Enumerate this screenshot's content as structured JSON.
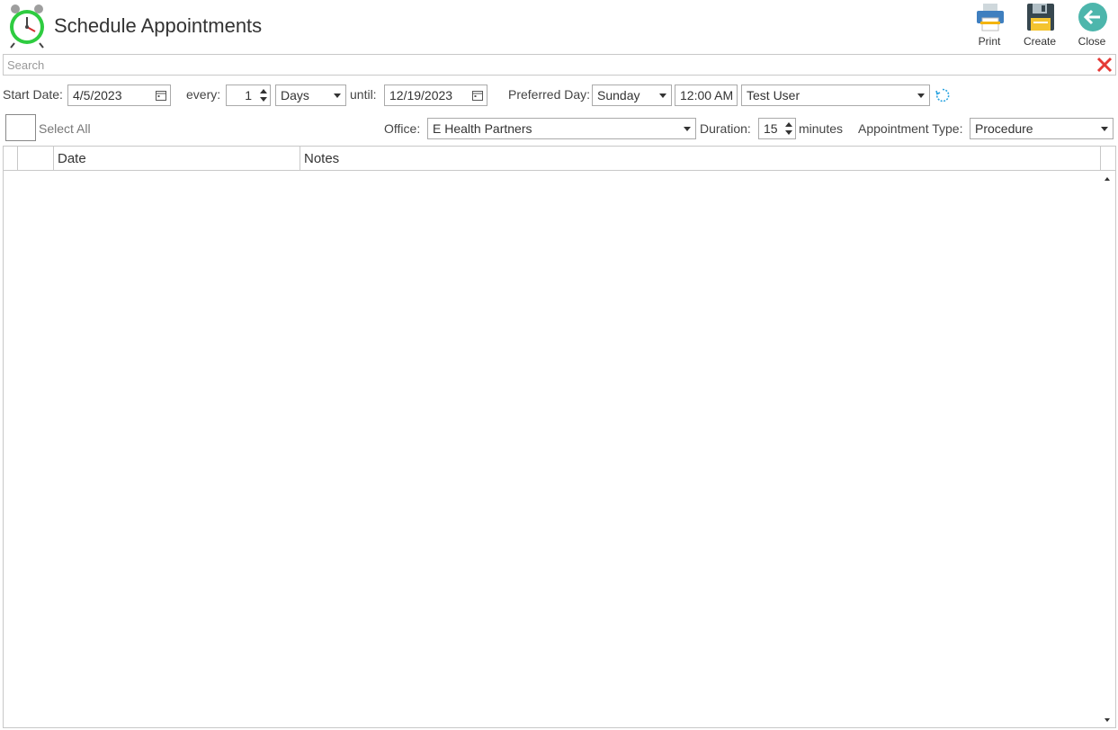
{
  "header": {
    "title": "Schedule Appointments",
    "app_icon": "alarm-clock-icon",
    "toolbar": [
      {
        "label": "Print",
        "icon": "printer-icon"
      },
      {
        "label": "Create",
        "icon": "floppy-disk-icon"
      },
      {
        "label": "Close",
        "icon": "back-arrow-icon"
      }
    ]
  },
  "search": {
    "placeholder": "Search",
    "value": "",
    "clear_icon": "close-x-icon"
  },
  "recurrence": {
    "start_date_label": "Start Date:",
    "start_date": "4/5/2023",
    "every_label": "every:",
    "every_value": "1",
    "interval_unit": "Days",
    "until_label": "until:",
    "until_date": "12/19/2023",
    "preferred_day_label": "Preferred Day:",
    "preferred_day": "Sunday",
    "time": "12:00 AM",
    "user": "Test User",
    "refresh_icon": "refresh-icon"
  },
  "options": {
    "select_all_label": "Select All",
    "office_label": "Office:",
    "office": "E Health Partners",
    "duration_label": "Duration:",
    "duration": "15",
    "duration_unit": "minutes",
    "appointment_type_label": "Appointment Type:",
    "appointment_type": "Procedure"
  },
  "grid": {
    "columns": [
      "",
      "",
      "Date",
      "Notes"
    ],
    "rows": []
  },
  "colors": {
    "accent": "#1e90ff",
    "close_red": "#e53935",
    "clock_green": "#2ecc40",
    "border": "#c8c8c8"
  }
}
